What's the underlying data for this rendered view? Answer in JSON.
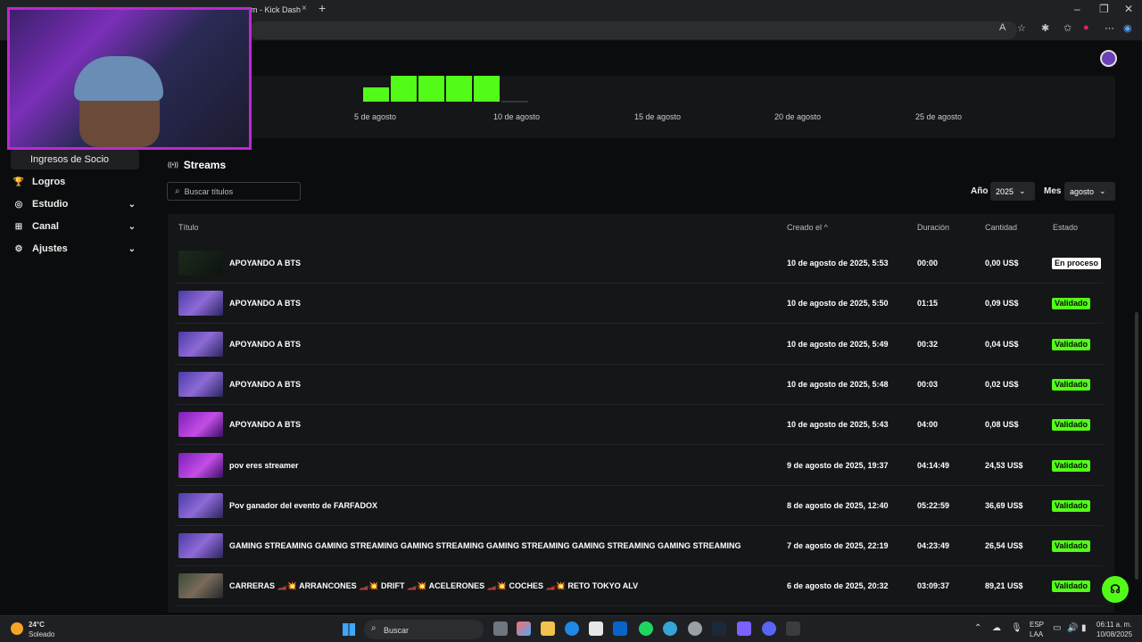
{
  "browser": {
    "tab_title": "am - Kick Dash",
    "tab_close": "×",
    "tab_new": "+",
    "minimize": "–",
    "restore": "❐",
    "close": "✕"
  },
  "chart_data": {
    "type": "bar",
    "x_ticks": [
      "5 de agosto",
      "10 de agosto",
      "15 de agosto",
      "20 de agosto",
      "25 de agosto"
    ],
    "visible_values": [
      0.55,
      1,
      1,
      1,
      1
    ],
    "color": "#53fc18"
  },
  "sidebar": {
    "items": [
      {
        "label": "Ingresos de Socio",
        "icon": "",
        "active": true,
        "chevron": ""
      },
      {
        "label": "Logros",
        "icon": "🏆",
        "chevron": ""
      },
      {
        "label": "Estudio",
        "icon": "◎",
        "chevron": "⌄"
      },
      {
        "label": "Canal",
        "icon": "⊞",
        "chevron": "⌄"
      },
      {
        "label": "Ajustes",
        "icon": "⚙",
        "chevron": "⌄"
      }
    ]
  },
  "streams": {
    "title": "Streams",
    "title_icon": "((•))",
    "search_placeholder": "Buscar títulos",
    "search_icon": "⌕",
    "year_label": "Año",
    "year_value": "2025",
    "month_label": "Mes",
    "month_value": "agosto",
    "columns": {
      "title": "Título",
      "created": "Creado el",
      "duration": "Duración",
      "amount": "Cantidad",
      "status": "Estado"
    },
    "sort_icon": "^",
    "rows": [
      {
        "title": "APOYANDO A BTS",
        "created": "10 de agosto de 2025, 5:53",
        "duration": "00:00",
        "amount": "0,00 US$",
        "status": "En proceso",
        "thumb": "dark"
      },
      {
        "title": "APOYANDO A BTS",
        "created": "10 de agosto de 2025, 5:50",
        "duration": "01:15",
        "amount": "0,09 US$",
        "status": "Validado",
        "thumb": "purple"
      },
      {
        "title": "APOYANDO A BTS",
        "created": "10 de agosto de 2025, 5:49",
        "duration": "00:32",
        "amount": "0,04 US$",
        "status": "Validado",
        "thumb": "purple"
      },
      {
        "title": "APOYANDO A BTS",
        "created": "10 de agosto de 2025, 5:48",
        "duration": "00:03",
        "amount": "0,02 US$",
        "status": "Validado",
        "thumb": "purple"
      },
      {
        "title": "APOYANDO A BTS",
        "created": "10 de agosto de 2025, 5:43",
        "duration": "04:00",
        "amount": "0,08 US$",
        "status": "Validado",
        "thumb": "magenta"
      },
      {
        "title": "pov eres streamer",
        "created": "9 de agosto de 2025, 19:37",
        "duration": "04:14:49",
        "amount": "24,53 US$",
        "status": "Validado",
        "thumb": "magenta"
      },
      {
        "title": "Pov ganador del evento de FARFADOX",
        "created": "8 de agosto de 2025, 12:40",
        "duration": "05:22:59",
        "amount": "36,69 US$",
        "status": "Validado",
        "thumb": "purple"
      },
      {
        "title": "GAMING STREAMING GAMING STREAMING GAMING STREAMING GAMING STREAMING GAMING STREAMING GAMING STREAMING",
        "created": "7 de agosto de 2025, 22:19",
        "duration": "04:23:49",
        "amount": "26,54 US$",
        "status": "Validado",
        "thumb": "purple"
      },
      {
        "title": "CARRERAS 🏎️💥 ARRANCONES 🏎️💥 DRIFT 🏎️💥 ACELERONES 🏎️💥 COCHES 🏎️💥 RETO TOKYO ALV",
        "created": "6 de agosto de 2025, 20:32",
        "duration": "03:09:37",
        "amount": "89,21 US$",
        "status": "Validado",
        "thumb": "game"
      }
    ]
  },
  "taskbar": {
    "weather_temp": "24°C",
    "weather_desc": "Soleado",
    "search_label": "Buscar",
    "lang_top": "ESP",
    "lang_bottom": "LAA",
    "time": "06:11 a. m.",
    "date": "10/08/2025"
  },
  "colors": {
    "accent": "#53fc18",
    "webcam_border": "#c026d3"
  }
}
